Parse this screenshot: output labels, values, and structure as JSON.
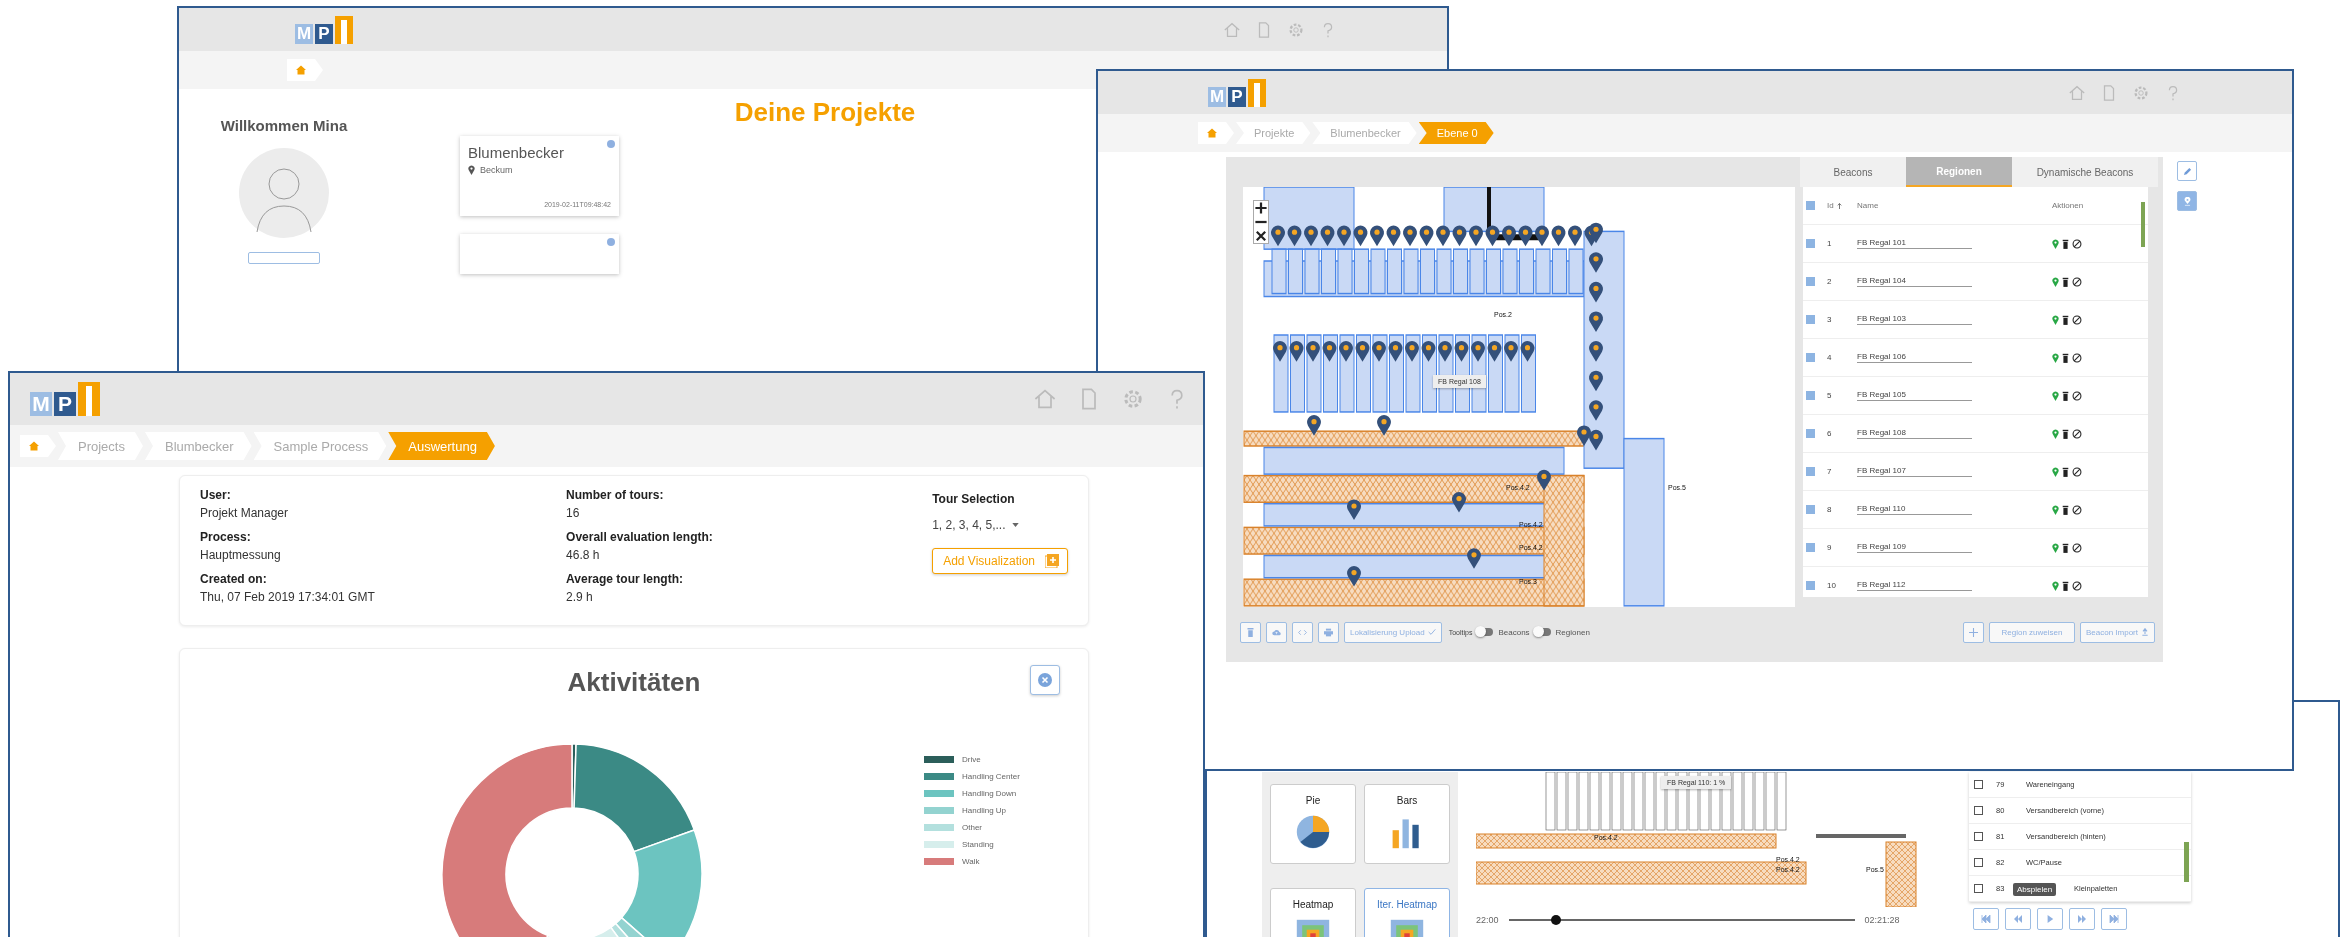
{
  "projects_window": {
    "logo": [
      "M",
      "P"
    ],
    "breadcrumb": [
      {
        "kind": "home",
        "selected": false
      }
    ],
    "heading": "Deine Projekte",
    "welcome": "Willkommen Mina",
    "projects": [
      {
        "name": "Blumenbecker",
        "location": "Beckum",
        "date": "2019-02-11T09:48:42"
      }
    ]
  },
  "map_window": {
    "logo": [
      "M",
      "P"
    ],
    "breadcrumb": [
      {
        "label": "Projekte",
        "selected": false
      },
      {
        "label": "Blumenbecker",
        "selected": false
      },
      {
        "label": "Ebene 0",
        "selected": true
      }
    ],
    "map": {
      "tooltip": "FB Regal 108",
      "labels": [
        "Pos.2",
        "Pos.4.2",
        "Pos.4.2",
        "Pos.4.2",
        "Pos.3",
        "Pos.5"
      ]
    },
    "tabs": [
      {
        "label": "Beacons",
        "selected": false
      },
      {
        "label": "Regionen",
        "selected": true
      },
      {
        "label": "Dynamische Beacons",
        "selected": false
      }
    ],
    "table": {
      "columns": [
        "Id",
        "Name",
        "Aktionen"
      ],
      "all_checked": true,
      "rows": [
        {
          "id": "1",
          "name": "FB Regal 101",
          "checked": true
        },
        {
          "id": "2",
          "name": "FB Regal 104",
          "checked": true
        },
        {
          "id": "3",
          "name": "FB Regal 103",
          "checked": true
        },
        {
          "id": "4",
          "name": "FB Regal 106",
          "checked": true
        },
        {
          "id": "5",
          "name": "FB Regal 105",
          "checked": true
        },
        {
          "id": "6",
          "name": "FB Regal 108",
          "checked": true
        },
        {
          "id": "7",
          "name": "FB Regal 107",
          "checked": true
        },
        {
          "id": "8",
          "name": "FB Regal 110",
          "checked": true
        },
        {
          "id": "9",
          "name": "FB Regal 109",
          "checked": true
        },
        {
          "id": "10",
          "name": "FB Regal 112",
          "checked": true
        }
      ]
    },
    "toolbar": {
      "upload_button": "Lokalisierung Upload",
      "tooltips_label": "Tooltips",
      "toggles": [
        {
          "label": "Beacons",
          "on": false
        },
        {
          "label": "Regionen",
          "on": false
        }
      ],
      "assign_button": "Region zuweisen",
      "import_button": "Beacon Import"
    }
  },
  "player_window": {
    "graph_styles": [
      {
        "label": "Pie",
        "kind": "pie",
        "selected": false
      },
      {
        "label": "Bars",
        "kind": "bars",
        "selected": false
      },
      {
        "label": "Heatmap",
        "kind": "heatmap",
        "selected": false
      },
      {
        "label": "Iter. Heatmap",
        "kind": "iter_heatmap",
        "selected": true
      }
    ],
    "map_tooltip": "FB Regal 110: 1 %",
    "map_labels": [
      "Pos.4.2",
      "Pos.4.2",
      "Pos.4.2",
      "Pos.5"
    ],
    "time_start": "22:00",
    "time_end": "02:21:28",
    "timeline": {
      "level": 0.136
    },
    "regions": [
      {
        "id": "79",
        "name": "Wareneingang",
        "checked": false
      },
      {
        "id": "80",
        "name": "Versandbereich (vorne)",
        "checked": false
      },
      {
        "id": "81",
        "name": "Versandbereich (hinten)",
        "checked": false
      },
      {
        "id": "82",
        "name": "WC/Pause",
        "checked": false
      },
      {
        "id": "83",
        "name": "Kleinpaletten",
        "checked": false
      }
    ],
    "play_tooltip": "Abspielen"
  },
  "evaluation_window": {
    "logo": [
      "M",
      "P"
    ],
    "breadcrumb": [
      {
        "label": "Projects",
        "selected": false
      },
      {
        "label": "Blumbecker",
        "selected": false
      },
      {
        "label": "Sample Process",
        "selected": false
      },
      {
        "label": "Auswertung",
        "selected": true
      }
    ],
    "info_columns": [
      [
        {
          "label": "User:",
          "value": "Projekt Manager"
        },
        {
          "label": "Process:",
          "value": "Hauptmessung"
        },
        {
          "label": "Created on:",
          "value": "Thu, 07 Feb 2019 17:34:01 GMT"
        }
      ],
      [
        {
          "label": "Number of tours:",
          "value": "16"
        },
        {
          "label": "Overall evaluation length:",
          "value": "46.8 h"
        },
        {
          "label": "Average tour length:",
          "value": "2.9 h"
        }
      ]
    ],
    "tour_selection": {
      "label": "Tour Selection",
      "value": "1, 2, 3, 4, 5,..."
    },
    "add_button": "Add Visualization",
    "chart": {
      "title": "Aktivitäten",
      "legend": [
        {
          "label": "Drive",
          "color": "#2b5e5a"
        },
        {
          "label": "Handling Center",
          "color": "#3b8a85"
        },
        {
          "label": "Handling Down",
          "color": "#6cc4c0"
        },
        {
          "label": "Handling Up",
          "color": "#93d3d0"
        },
        {
          "label": "Other",
          "color": "#b3e0de"
        },
        {
          "label": "Standing",
          "color": "#d6eeec"
        },
        {
          "label": "Walk",
          "color": "#d77b7b"
        }
      ]
    }
  }
}
